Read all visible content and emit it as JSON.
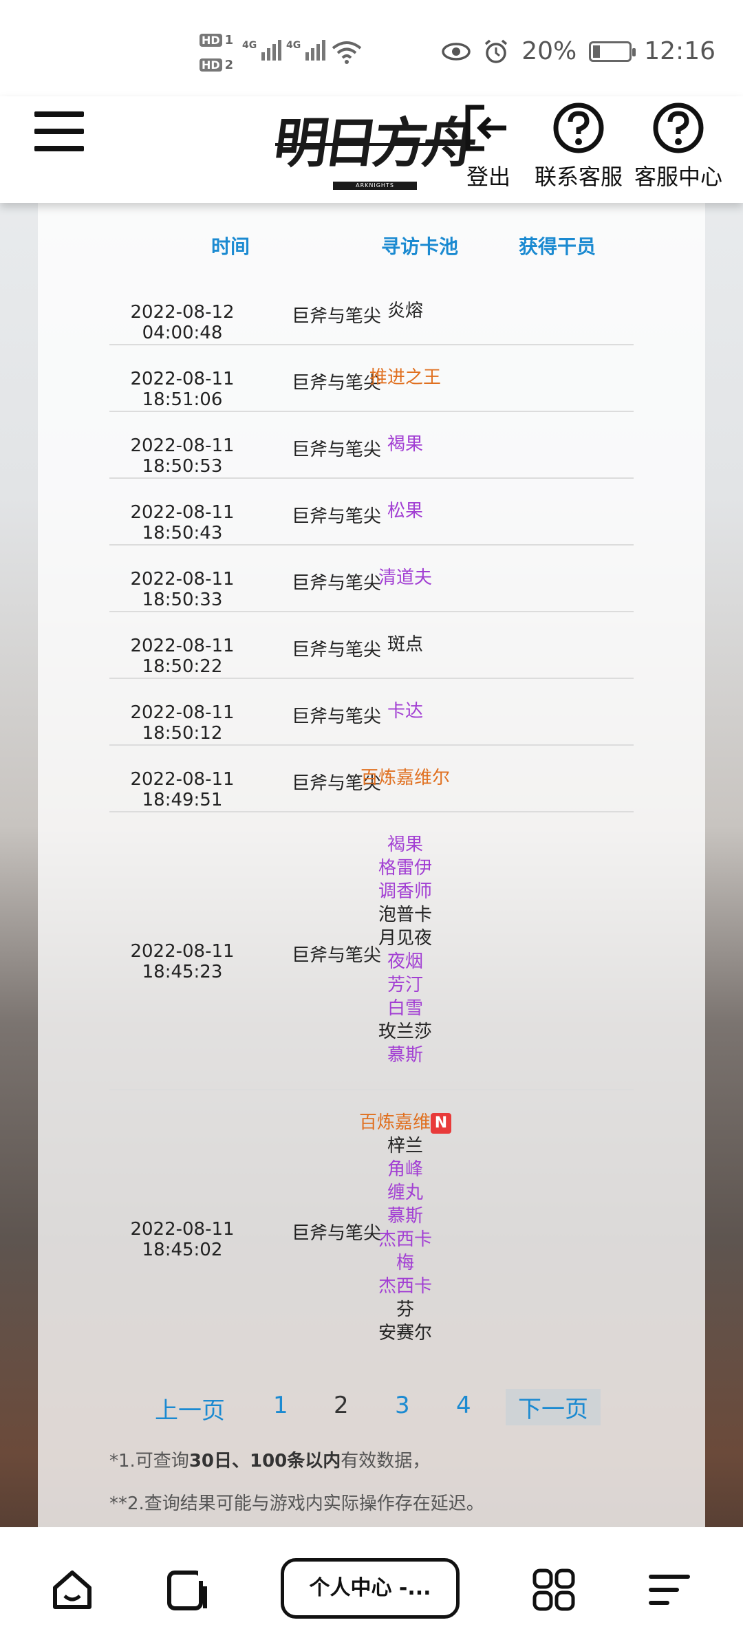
{
  "status_bar": {
    "hd1": "HD",
    "hd1_num": "1",
    "hd2": "HD",
    "hd2_num": "2",
    "net1": "4G",
    "net2": "4G",
    "battery": "20%",
    "time": "12:16"
  },
  "header": {
    "logo_text": "明日方舟",
    "logo_sub": "ARKNIGHTS",
    "logout_label": "登出",
    "contact_label": "联系客服",
    "help_label": "客服中心"
  },
  "table": {
    "headers": [
      "时间",
      "寻访卡池",
      "获得干员"
    ],
    "rows": [
      {
        "time": "2022-08-12 04:00:48",
        "pool": "巨斧与笔尖",
        "operators": [
          {
            "name": "炎熔",
            "rarity": 3
          }
        ]
      },
      {
        "time": "2022-08-11 18:51:06",
        "pool": "巨斧与笔尖",
        "operators": [
          {
            "name": "推进之王",
            "rarity": 6
          }
        ]
      },
      {
        "time": "2022-08-11 18:50:53",
        "pool": "巨斧与笔尖",
        "operators": [
          {
            "name": "褐果",
            "rarity": 4
          }
        ]
      },
      {
        "time": "2022-08-11 18:50:43",
        "pool": "巨斧与笔尖",
        "operators": [
          {
            "name": "松果",
            "rarity": 4
          }
        ]
      },
      {
        "time": "2022-08-11 18:50:33",
        "pool": "巨斧与笔尖",
        "operators": [
          {
            "name": "清道夫",
            "rarity": 4
          }
        ]
      },
      {
        "time": "2022-08-11 18:50:22",
        "pool": "巨斧与笔尖",
        "operators": [
          {
            "name": "斑点",
            "rarity": 3
          }
        ]
      },
      {
        "time": "2022-08-11 18:50:12",
        "pool": "巨斧与笔尖",
        "operators": [
          {
            "name": "卡达",
            "rarity": 4
          }
        ]
      },
      {
        "time": "2022-08-11 18:49:51",
        "pool": "巨斧与笔尖",
        "operators": [
          {
            "name": "百炼嘉维尔",
            "rarity": 6
          }
        ]
      },
      {
        "time": "2022-08-11 18:45:23",
        "pool": "巨斧与笔尖",
        "operators": [
          {
            "name": "褐果",
            "rarity": 4
          },
          {
            "name": "格雷伊",
            "rarity": 4
          },
          {
            "name": "调香师",
            "rarity": 4
          },
          {
            "name": "泡普卡",
            "rarity": 3
          },
          {
            "name": "月见夜",
            "rarity": 3
          },
          {
            "name": "夜烟",
            "rarity": 4
          },
          {
            "name": "芳汀",
            "rarity": 4
          },
          {
            "name": "白雪",
            "rarity": 4
          },
          {
            "name": "玫兰莎",
            "rarity": 3
          },
          {
            "name": "慕斯",
            "rarity": 4
          }
        ]
      },
      {
        "time": "2022-08-11 18:45:02",
        "pool": "巨斧与笔尖",
        "operators": [
          {
            "name": "百炼嘉维",
            "rarity": 6,
            "badge": "N"
          },
          {
            "name": "梓兰",
            "rarity": 3
          },
          {
            "name": "角峰",
            "rarity": 4
          },
          {
            "name": "缠丸",
            "rarity": 4
          },
          {
            "name": "慕斯",
            "rarity": 4
          },
          {
            "name": "杰西卡",
            "rarity": 4
          },
          {
            "name": "梅",
            "rarity": 4
          },
          {
            "name": "杰西卡",
            "rarity": 4
          },
          {
            "name": "芬",
            "rarity": 3
          },
          {
            "name": "安赛尔",
            "rarity": 3
          }
        ]
      }
    ]
  },
  "pager": {
    "prev": "上一页",
    "pages": [
      "1",
      "2",
      "3",
      "4"
    ],
    "current": "2",
    "next": "下一页"
  },
  "notes": {
    "note1_prefix": "*1.可查询",
    "note1_bold": "30日、100条以内",
    "note1_suffix": "有效数据，",
    "note2": "**2.查询结果可能与游戏内实际操作存在延迟。"
  },
  "bottom_nav": {
    "tab_label": "个人中心 -..."
  },
  "colors": {
    "accent_blue": "#1b8ad1",
    "rarity4_purple": "#a23fd3",
    "rarity6_orange": "#e07020",
    "new_badge_red": "#e83a3a"
  }
}
